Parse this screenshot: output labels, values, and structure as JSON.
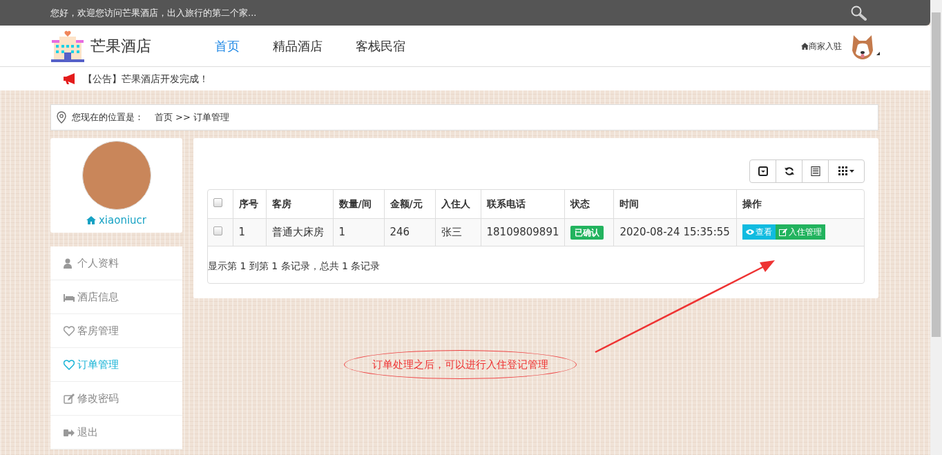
{
  "top_bar": {
    "welcome": "您好，欢迎您访问芒果酒店，出入旅行的第二个家..."
  },
  "header": {
    "logo_text": "芒果酒店",
    "nav": [
      {
        "label": "首页",
        "selected": true
      },
      {
        "label": "精品酒店",
        "selected": false
      },
      {
        "label": "客栈民宿",
        "selected": false
      }
    ],
    "merchant_link": "商家入驻"
  },
  "notice": "【公告】芒果酒店开发完成！",
  "breadcrumb": {
    "label": "您现在的位置是：",
    "items": [
      "首页",
      ">>",
      "订单管理"
    ]
  },
  "profile": {
    "username": "xiaoniucr"
  },
  "sidebar": {
    "items": [
      {
        "label": "个人资料",
        "selected": false
      },
      {
        "label": "酒店信息",
        "selected": false
      },
      {
        "label": "客房管理",
        "selected": false
      },
      {
        "label": "订单管理",
        "selected": true
      },
      {
        "label": "修改密码",
        "selected": false
      },
      {
        "label": "退出",
        "selected": false
      }
    ]
  },
  "table": {
    "select_all_checked": false,
    "columns": [
      "序号",
      "客房",
      "数量/间",
      "金额/元",
      "入住人",
      "联系电话",
      "状态",
      "时间",
      "操作"
    ],
    "rows": [
      {
        "checked": false,
        "cells": [
          "1",
          "普通大床房",
          "1",
          "246",
          "张三",
          "18109809891"
        ],
        "status": "已确认",
        "time": "2020-08-24 15:35:55",
        "actions": [
          "查看",
          "入住管理"
        ]
      }
    ],
    "footer": "显示第 1 到第 1 条记录，总共 1 条记录"
  },
  "annotation": "订单处理之后，可以进行入住登记管理"
}
